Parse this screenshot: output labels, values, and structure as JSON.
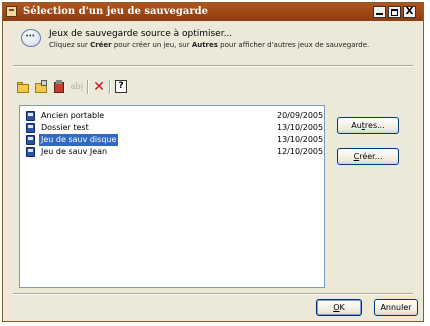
{
  "window": {
    "title": "Sélection d'un jeu de sauvegarde",
    "controls": {
      "close": "X"
    }
  },
  "header": {
    "title": "Jeux de sauvegarde source à optimiser...",
    "hint_prefix": "Cliquez sur ",
    "hint_create": "Créer",
    "hint_middle": " pour créer un jeu, sur ",
    "hint_other": "Autres",
    "hint_suffix": " pour afficher d'autres jeux de sauvegarde."
  },
  "toolbar": {
    "rename_label": "ab|",
    "delete_label": "✕"
  },
  "sets": [
    {
      "name": "Ancien portable",
      "date": "20/09/2005",
      "selected": false
    },
    {
      "name": "Dossier test",
      "date": "13/10/2005",
      "selected": false
    },
    {
      "name": "Jeu de sauv disque",
      "date": "13/10/2005",
      "selected": true
    },
    {
      "name": "Jeu de sauv Jean",
      "date": "12/10/2005",
      "selected": false
    }
  ],
  "buttons": {
    "autres_prefix": "Au",
    "autres_ul": "t",
    "autres_suffix": "res...",
    "creer_ul": "C",
    "creer_suffix": "réer...",
    "ok_ul": "O",
    "ok_suffix": "K",
    "annuler": "Annuler"
  },
  "colors": {
    "titlebar": "#a04a18",
    "selection": "#316ac5",
    "dialog_bg": "#ece9d8"
  }
}
